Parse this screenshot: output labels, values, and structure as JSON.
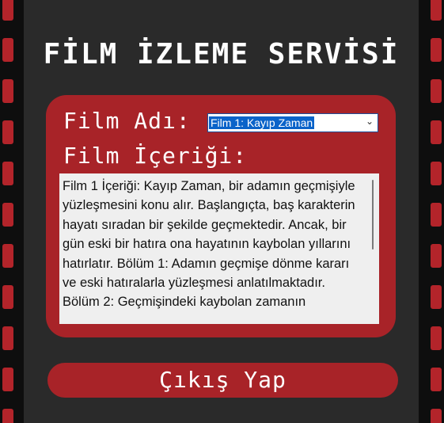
{
  "app": {
    "title": "FİLM İZLEME SERVİSİ"
  },
  "form": {
    "film_name_label": "Film Adı:",
    "selected_film": "Film 1: Kayıp Zaman",
    "content_label": "Film İçeriği:",
    "content_text": "Film 1 İçeriği: Kayıp Zaman, bir adamın geçmişiyle yüzleşmesini konu alır. Başlangıçta, baş karakterin hayatı sıradan bir şekilde geçmektedir. Ancak, bir gün eski bir hatıra ona hayatının kaybolan yıllarını hatırlatır. Bölüm 1: Adamın geçmişe dönme kararı ve eski hatıralarla yüzleşmesi anlatılmaktadır. Bölüm 2: Geçmişindeki kaybolan zamanın"
  },
  "actions": {
    "exit_label": "Çıkış Yap"
  },
  "colors": {
    "background": "#2a2a2a",
    "accent_red": "#a82328",
    "film_strip": "#0e0e0e",
    "selection_blue": "#0a63c9"
  },
  "icons": {
    "select_arrow": "chevron-down-icon"
  }
}
